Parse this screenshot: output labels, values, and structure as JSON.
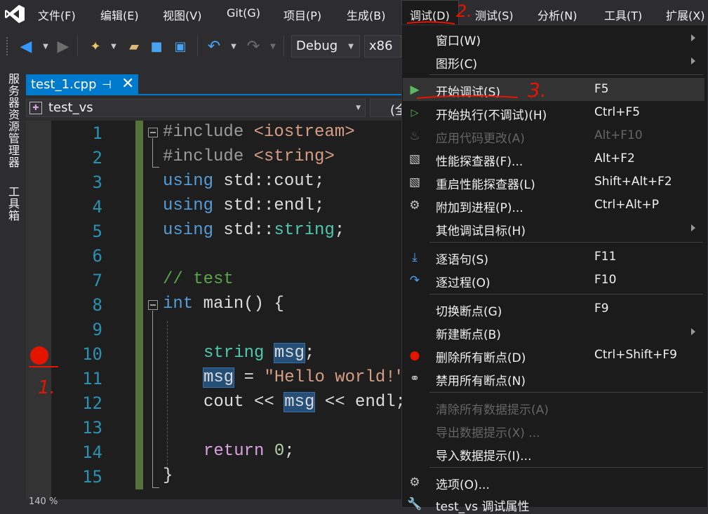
{
  "menubar": {
    "items": [
      "文件(F)",
      "编辑(E)",
      "视图(V)",
      "Git(G)",
      "项目(P)",
      "生成(B)",
      "调试(D)",
      "测试(S)",
      "分析(N)",
      "工具(T)",
      "扩展(X)"
    ],
    "active_index": 6
  },
  "toolbar": {
    "config": "Debug",
    "platform": "x86"
  },
  "side_strip": [
    "服务器资源管理器",
    "工具箱"
  ],
  "editor": {
    "tab": "test_1.cpp",
    "pin_glyph": "⊣",
    "close_glyph": "✕",
    "nav_scope": "test_vs",
    "nav_right": "(全",
    "line_numbers": [
      "1",
      "2",
      "3",
      "4",
      "5",
      "6",
      "7",
      "8",
      "9",
      "10",
      "11",
      "12",
      "13",
      "14",
      "15"
    ],
    "code": {
      "l1_pp": "#include ",
      "l1_inc": "<iostream>",
      "l2_pp": "#include ",
      "l2_inc": "<string>",
      "l3_kw": "using",
      "l3_rest": " std::cout;",
      "l4_kw": "using",
      "l4_rest": " std::endl;",
      "l5_kw": "using",
      "l5_ns": " std::",
      "l5_ty": "string",
      "l5_end": ";",
      "l7": "// test",
      "l8_kw": "int",
      "l8_rest": " main() {",
      "l10_ty": "string",
      "l10_var": "msg",
      "l10_end": ";",
      "l11_var": "msg",
      "l11_op": " = ",
      "l11_str": "\"Hello world!\"",
      "l12_a": "cout << ",
      "l12_var": "msg",
      "l12_b": " << endl;",
      "l14_kw": "return",
      "l14_num": "0",
      "l14_end": ";",
      "l15": "}"
    },
    "status_zoom": "140 %"
  },
  "annotations": {
    "one": "1.",
    "two": "2.",
    "three": "3."
  },
  "debug_menu": {
    "items": [
      {
        "label": "窗口(W)",
        "shortcut": ""
      },
      {
        "label": "图形(C)",
        "shortcut": ""
      },
      {
        "label": "开始调试(S)",
        "shortcut": "F5"
      },
      {
        "label": "开始执行(不调试)(H)",
        "shortcut": "Ctrl+F5"
      },
      {
        "label": "应用代码更改(A)",
        "shortcut": "Alt+F10"
      },
      {
        "label": "性能探查器(F)...",
        "shortcut": "Alt+F2"
      },
      {
        "label": "重启性能探查器(L)",
        "shortcut": "Shift+Alt+F2"
      },
      {
        "label": "附加到进程(P)...",
        "shortcut": "Ctrl+Alt+P"
      },
      {
        "label": "其他调试目标(H)",
        "shortcut": ""
      },
      {
        "label": "逐语句(S)",
        "shortcut": "F11"
      },
      {
        "label": "逐过程(O)",
        "shortcut": "F10"
      },
      {
        "label": "切换断点(G)",
        "shortcut": "F9"
      },
      {
        "label": "新建断点(B)",
        "shortcut": ""
      },
      {
        "label": "删除所有断点(D)",
        "shortcut": "Ctrl+Shift+F9"
      },
      {
        "label": "禁用所有断点(N)",
        "shortcut": ""
      },
      {
        "label": "清除所有数据提示(A)",
        "shortcut": ""
      },
      {
        "label": "导出数据提示(X) ...",
        "shortcut": ""
      },
      {
        "label": "导入数据提示(I)...",
        "shortcut": ""
      },
      {
        "label": "选项(O)...",
        "shortcut": ""
      },
      {
        "label": "test_vs 调试属性",
        "shortcut": ""
      }
    ]
  },
  "colors": {
    "accent": "#007acc",
    "breakpoint": "#e51400",
    "play": "#5db862"
  }
}
